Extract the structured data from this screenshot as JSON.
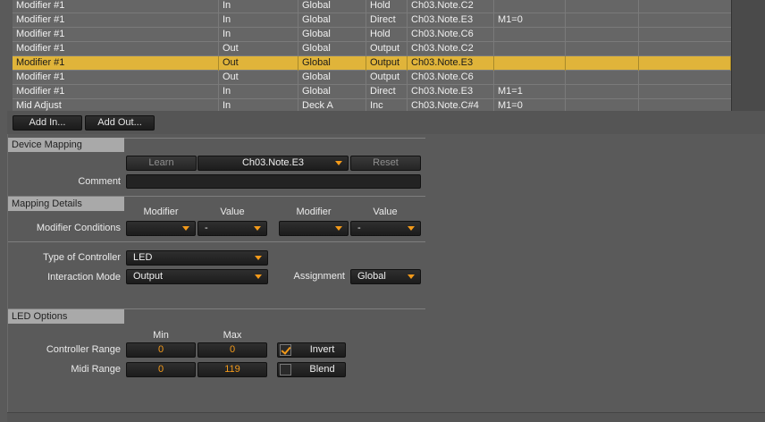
{
  "table": {
    "rows": [
      {
        "cells": [
          "Modifier #1",
          "In",
          "Global",
          "Hold",
          "Ch03.Note.C2",
          "",
          "",
          ""
        ]
      },
      {
        "cells": [
          "Modifier #1",
          "In",
          "Global",
          "Direct",
          "Ch03.Note.E3",
          "M1=0",
          "",
          ""
        ]
      },
      {
        "cells": [
          "Modifier #1",
          "In",
          "Global",
          "Hold",
          "Ch03.Note.C6",
          "",
          "",
          ""
        ]
      },
      {
        "cells": [
          "Modifier #1",
          "Out",
          "Global",
          "Output",
          "Ch03.Note.C2",
          "",
          "",
          ""
        ]
      },
      {
        "cells": [
          "Modifier #1",
          "Out",
          "Global",
          "Output",
          "Ch03.Note.E3",
          "",
          "",
          ""
        ],
        "selected": true
      },
      {
        "cells": [
          "Modifier #1",
          "Out",
          "Global",
          "Output",
          "Ch03.Note.C6",
          "",
          "",
          ""
        ]
      },
      {
        "cells": [
          "Modifier #1",
          "In",
          "Global",
          "Direct",
          "Ch03.Note.E3",
          "M1=1",
          "",
          ""
        ]
      },
      {
        "cells": [
          "Mid Adjust",
          "In",
          "Deck A",
          "Inc",
          "Ch03.Note.C#4",
          "M1=0",
          "",
          ""
        ]
      }
    ],
    "selected_color": "#e0b43a"
  },
  "toolbar": {
    "add_in": "Add In...",
    "add_out": "Add Out..."
  },
  "device_mapping": {
    "header": "Device Mapping",
    "learn": "Learn",
    "control": "Ch03.Note.E3",
    "reset": "Reset",
    "comment_label": "Comment",
    "comment_value": ""
  },
  "mapping_details": {
    "header": "Mapping Details",
    "modifier_col1": "Modifier",
    "value_col1": "Value",
    "modifier_col2": "Modifier",
    "value_col2": "Value",
    "modifier_conditions_label": "Modifier Conditions",
    "cond1_modifier": "",
    "cond1_value": "-",
    "cond2_modifier": "",
    "cond2_value": "-",
    "type_label": "Type of Controller",
    "type_value": "LED",
    "interaction_label": "Interaction Mode",
    "interaction_value": "Output",
    "assignment_label": "Assignment",
    "assignment_value": "Global"
  },
  "led_options": {
    "header": "LED Options",
    "min_label": "Min",
    "max_label": "Max",
    "controller_range_label": "Controller Range",
    "controller_min": "0",
    "controller_max": "0",
    "invert_label": "Invert",
    "invert_checked": true,
    "midi_range_label": "Midi Range",
    "midi_min": "0",
    "midi_max": "119",
    "blend_label": "Blend",
    "blend_checked": false
  },
  "colors": {
    "accent": "#f39a1a",
    "section_header": "#a9a9a9"
  }
}
